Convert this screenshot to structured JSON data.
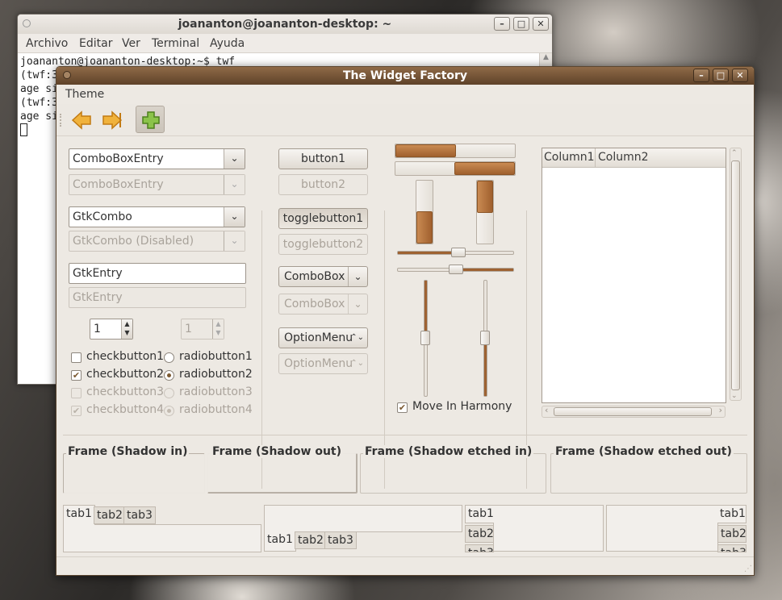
{
  "terminal": {
    "title": "joananton@joananton-desktop: ~",
    "menu": [
      "Archivo",
      "Editar",
      "Ver",
      "Terminal",
      "Ayuda"
    ],
    "lines": [
      "joananton@joananton-desktop:~$ twf",
      "",
      "(twf:3",
      "age si",
      "",
      "(twf:3",
      "age si"
    ]
  },
  "factory": {
    "title": "The Widget Factory",
    "menu": "Theme",
    "left": {
      "combo_entry": "ComboBoxEntry",
      "combo_entry_dis": "ComboBoxEntry",
      "gtk_combo": "GtkCombo",
      "gtk_combo_dis": "GtkCombo (Disabled)",
      "entry": "GtkEntry",
      "entry_dis": "GtkEntry",
      "spin": "1",
      "spin_dis": "1",
      "check1": "checkbutton1",
      "check2": "checkbutton2",
      "check3": "checkbutton3",
      "check4": "checkbutton4",
      "radio1": "radiobutton1",
      "radio2": "radiobutton2",
      "radio3": "radiobutton3",
      "radio4": "radiobutton4"
    },
    "buttons": {
      "button1": "button1",
      "button2": "button2",
      "toggle1": "togglebutton1",
      "toggle2": "togglebutton2",
      "combobox": "ComboBox",
      "combobox_dis": "ComboBox",
      "option": "OptionMenu",
      "option_dis": "OptionMenu"
    },
    "sliders": {
      "harmony": "Move In Harmony"
    },
    "tree": {
      "col1": "Column1",
      "col2": "Column2"
    },
    "frames": [
      "Frame (Shadow in)",
      "Frame (Shadow out)",
      "Frame (Shadow etched in)",
      "Frame (Shadow etched out)"
    ],
    "tabs": [
      "tab1",
      "tab2",
      "tab3"
    ]
  }
}
